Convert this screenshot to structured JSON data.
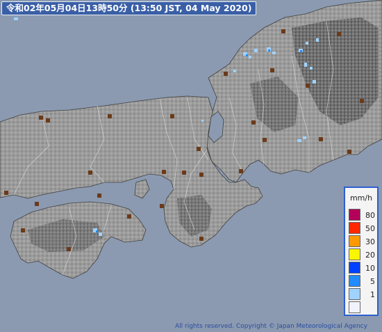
{
  "title": {
    "text": "令和02年05月04日13時50分  (13:50 JST, 04 May 2020)"
  },
  "legend": {
    "unit": "mm/h",
    "items": [
      {
        "label": "80",
        "color": "#b4005a"
      },
      {
        "label": "50",
        "color": "#ff2800"
      },
      {
        "label": "30",
        "color": "#ff9900"
      },
      {
        "label": "20",
        "color": "#faf500"
      },
      {
        "label": "10",
        "color": "#0041ff"
      },
      {
        "label": "5",
        "color": "#218cff"
      },
      {
        "label": "1",
        "color": "#a0d2ff"
      },
      {
        "label": "",
        "color": "#f2f2ff"
      }
    ]
  },
  "copyright": "All rights reserved. Copyright © Japan Meteorological Agency",
  "colors": {
    "sea": "#8b9ab0",
    "land_low": "#a8a8a8",
    "land_high": "#555555",
    "station": "#6b3a1a",
    "rain_light": "#a0d2ff",
    "rain_medium": "#218cff"
  }
}
